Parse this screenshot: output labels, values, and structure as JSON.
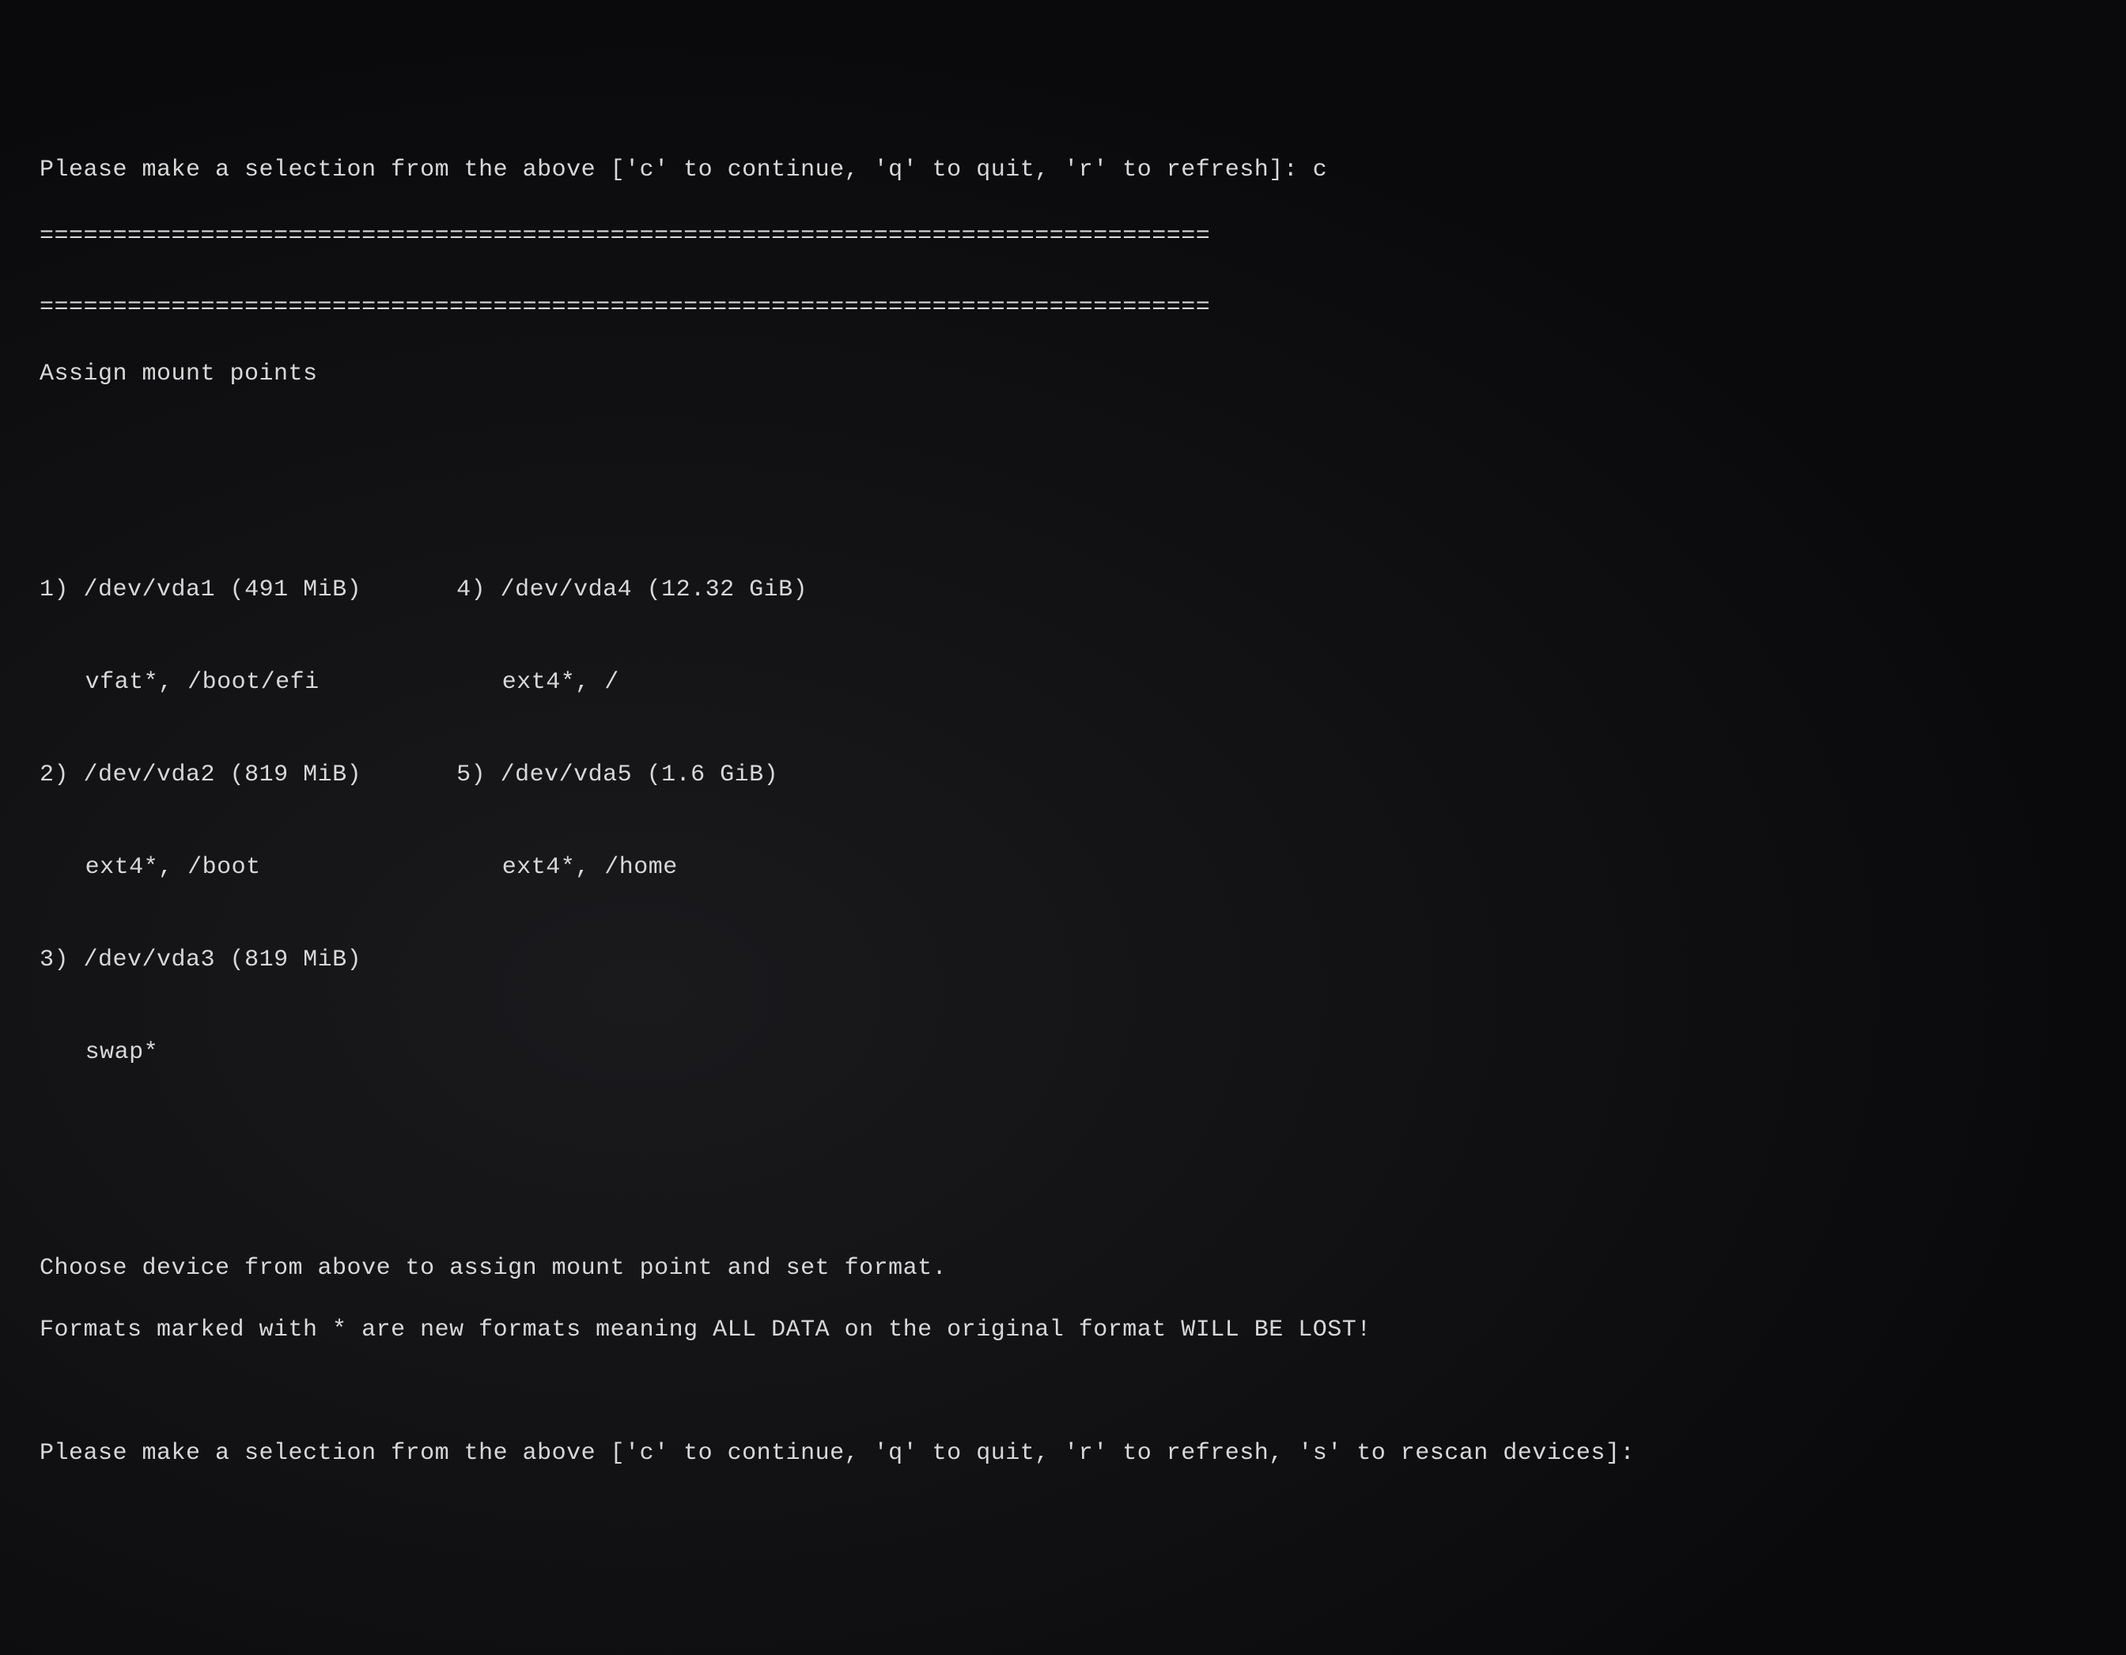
{
  "prompt1": {
    "text": "Please make a selection from the above ['c' to continue, 'q' to quit, 'r' to refresh]: ",
    "input": "c"
  },
  "divider": "================================================================================",
  "section_title": "Assign mount points",
  "devices_left": [
    {
      "num": "1)",
      "dev": "/dev/vda1 (491 MiB)",
      "fmt": "vfat*, /boot/efi"
    },
    {
      "num": "2)",
      "dev": "/dev/vda2 (819 MiB)",
      "fmt": "ext4*, /boot"
    },
    {
      "num": "3)",
      "dev": "/dev/vda3 (819 MiB)",
      "fmt": "swap*"
    }
  ],
  "devices_right": [
    {
      "num": "4)",
      "dev": "/dev/vda4 (12.32 GiB)",
      "fmt": "ext4*, /"
    },
    {
      "num": "5)",
      "dev": "/dev/vda5 (1.6 GiB)",
      "fmt": "ext4*, /home"
    }
  ],
  "help1": "Choose device from above to assign mount point and set format.",
  "help2": "Formats marked with * are new formats meaning ALL DATA on the original format WILL BE LOST!",
  "prompt2": {
    "text": "Please make a selection from the above ['c' to continue, 'q' to quit, 'r' to refresh, 's' to rescan devices]: "
  }
}
